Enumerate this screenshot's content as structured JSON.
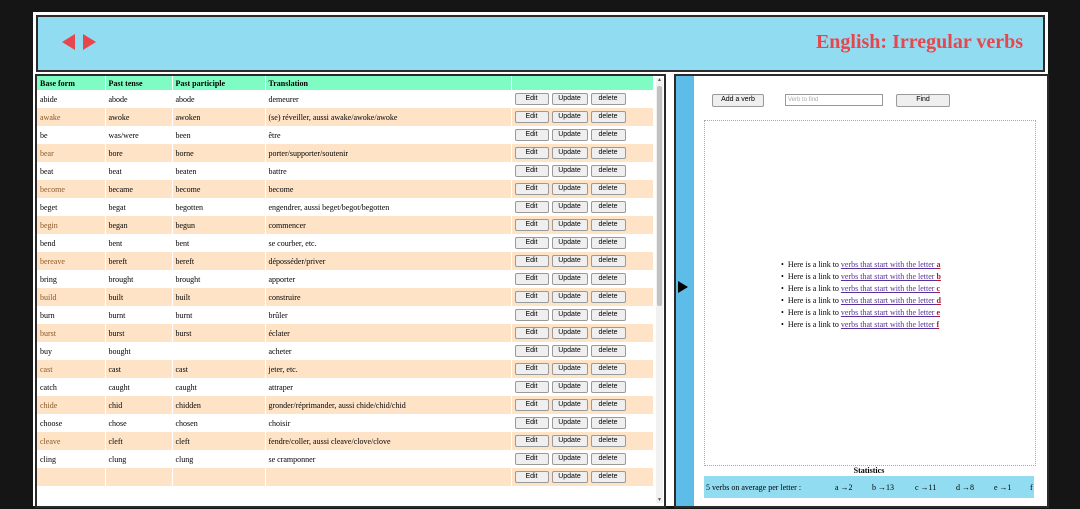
{
  "header": {
    "title": "English: Irregular verbs"
  },
  "table": {
    "columns": [
      "Base form",
      "Past tense",
      "Past participle",
      "Translation",
      ""
    ],
    "rows": [
      [
        "abide",
        "abode",
        "abode",
        "demeurer"
      ],
      [
        "awake",
        "awoke",
        "awoken",
        "(se) réveiller, aussi awake/awoke/awoke"
      ],
      [
        "be",
        "was/were",
        "been",
        "être"
      ],
      [
        "bear",
        "bore",
        "borne",
        "porter/supporter/soutenir"
      ],
      [
        "beat",
        "beat",
        "beaten",
        "battre"
      ],
      [
        "become",
        "became",
        "become",
        "become"
      ],
      [
        "beget",
        "begat",
        "begotten",
        "engendrer, aussi beget/begot/begotten"
      ],
      [
        "begin",
        "began",
        "begun",
        "commencer"
      ],
      [
        "bend",
        "bent",
        "bent",
        "se courber, etc."
      ],
      [
        "bereave",
        "bereft",
        "bereft",
        "déposséder/priver"
      ],
      [
        "bring",
        "brought",
        "brought",
        "apporter"
      ],
      [
        "build",
        "built",
        "built",
        "construire"
      ],
      [
        "burn",
        "burnt",
        "burnt",
        "brûler"
      ],
      [
        "burst",
        "burst",
        "burst",
        "éclater"
      ],
      [
        "buy",
        "bought",
        "",
        "acheter"
      ],
      [
        "cast",
        "cast",
        "cast",
        "jeter, etc."
      ],
      [
        "catch",
        "caught",
        "caught",
        "attraper"
      ],
      [
        "chide",
        "chid",
        "chidden",
        "gronder/réprimander, aussi chide/chid/chid"
      ],
      [
        "choose",
        "chose",
        "chosen",
        "choisir"
      ],
      [
        "cleave",
        "cleft",
        "cleft",
        "fendre/coller, aussi cleave/clove/clove"
      ],
      [
        "cling",
        "clung",
        "clung",
        "se cramponner"
      ],
      [
        "",
        "",
        "",
        ""
      ]
    ],
    "buttons": {
      "edit": "Edit",
      "update": "Update",
      "delete": "delete"
    }
  },
  "right": {
    "add_button": "Add a verb",
    "find_placeholder": "Verb to find",
    "find_button": "Find",
    "link_prefix": "Here is a link to ",
    "link_text": "verbs that start with the letter ",
    "letters": [
      "a",
      "b",
      "c",
      "d",
      "e",
      "f"
    ],
    "stats_title": "Statistics",
    "stats_summary": "5 verbs on average per letter :",
    "stats": [
      "a →2",
      "b →13",
      "c →11",
      "d →8",
      "e →1",
      "f"
    ]
  },
  "colors": {
    "header_bg": "#92dcf2",
    "accent_red": "#e8464d",
    "table_header": "#7ffcc4",
    "row_alt": "#ffe3c6"
  }
}
